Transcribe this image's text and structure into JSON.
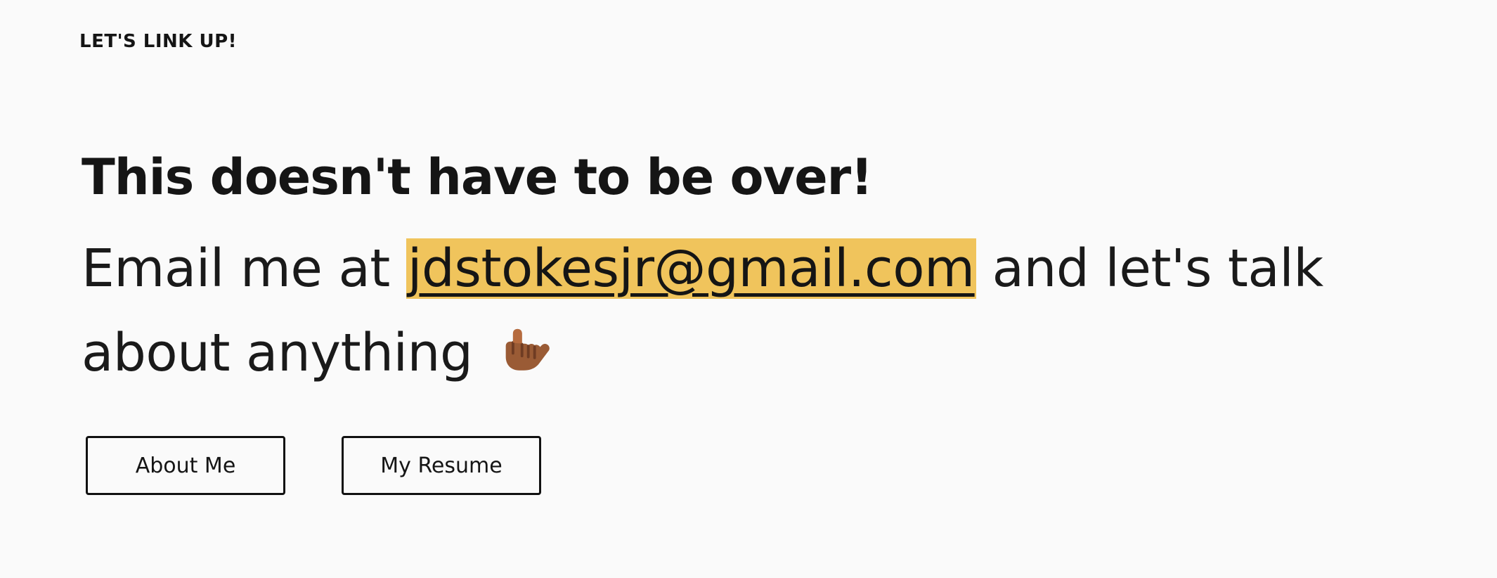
{
  "header": {
    "eyebrow": "LET'S LINK UP!"
  },
  "hero": {
    "title": "This doesn't have to be over!",
    "text_before": "Email me at ",
    "email": "jdstokesjr@gmail.com",
    "text_after": " and let's talk about anything",
    "emoji_icon": "call-me-hand-icon"
  },
  "buttons": {
    "about_label": "About Me",
    "resume_label": "My Resume"
  },
  "colors": {
    "background": "#fafafa",
    "text": "#151515",
    "email_highlight": "#f0c45c",
    "button_border": "#111111"
  }
}
